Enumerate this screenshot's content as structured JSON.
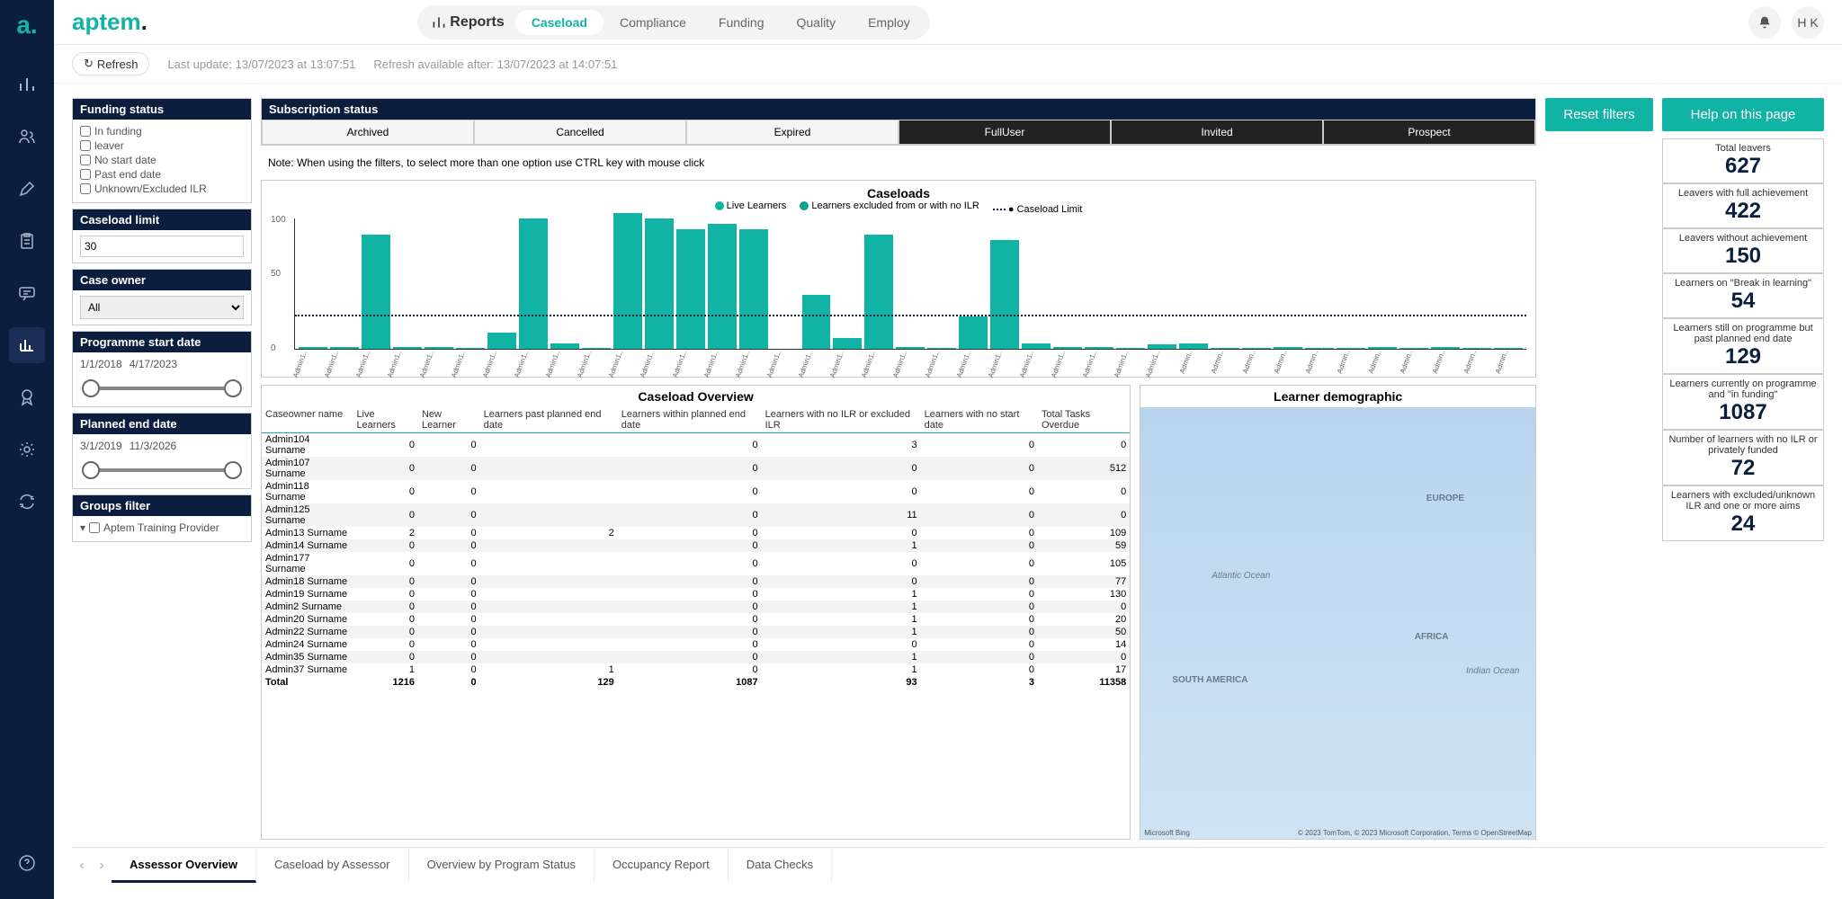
{
  "brand": "aptem",
  "top_tabs": {
    "label": "Reports",
    "items": [
      "Caseload",
      "Compliance",
      "Funding",
      "Quality",
      "Employ"
    ],
    "active": "Caseload"
  },
  "user_initials": "H K",
  "refresh": {
    "btn": "Refresh",
    "last": "Last update: 13/07/2023 at 13:07:51",
    "avail": "Refresh available after: 13/07/2023 at 14:07:51"
  },
  "filters": {
    "funding_status": {
      "title": "Funding status",
      "items": [
        "In funding",
        "leaver",
        "No start date",
        "Past end date",
        "Unknown/Excluded ILR"
      ]
    },
    "caseload_limit": {
      "title": "Caseload limit",
      "value": "30"
    },
    "case_owner": {
      "title": "Case owner",
      "value": "All"
    },
    "prog_start": {
      "title": "Programme start date",
      "from": "1/1/2018",
      "to": "4/17/2023"
    },
    "planned_end": {
      "title": "Planned end date",
      "from": "3/1/2019",
      "to": "11/3/2026"
    },
    "groups": {
      "title": "Groups filter",
      "item": "Aptem Training Provider"
    }
  },
  "sub_status": {
    "title": "Subscription status",
    "tabs": [
      "Archived",
      "Cancelled",
      "Expired",
      "FullUser",
      "Invited",
      "Prospect"
    ],
    "dark": [
      "FullUser",
      "Invited",
      "Prospect"
    ]
  },
  "note_label": "Note:",
  "note": "When using the filters, to select more than one option use CTRL key with mouse click",
  "actions": {
    "reset": "Reset filters",
    "help": "Help on this page"
  },
  "chart_data": {
    "type": "bar",
    "title": "Caseloads",
    "legend": [
      "Live Learners",
      "Learners excluded from or with no ILR",
      "Caseload Limit"
    ],
    "ylabel": "",
    "ylim": [
      0,
      120
    ],
    "yticks": [
      0,
      50,
      100
    ],
    "caseload_limit": 30,
    "categories": [
      "Admin1..",
      "Admin1..",
      "Admin1..",
      "Admin1..",
      "Admin1..",
      "Admin1..",
      "Admin1..",
      "Admin1..",
      "Admin1..",
      "Admin1..",
      "Admin1..",
      "Admin1..",
      "Admin1..",
      "Admin1..",
      "Admin1..",
      "Admin1..",
      "Admin1..",
      "Admin1..",
      "Admin1..",
      "Admin1..",
      "Admin1..",
      "Admin1..",
      "Admin1..",
      "Admin1..",
      "Admin1..",
      "Admin1..",
      "Admin1..",
      "Admin1..",
      "Admin..",
      "Admin..",
      "Admin..",
      "Admin..",
      "Admin..",
      "Admin..",
      "Admin..",
      "Admin..",
      "Admin..",
      "Admin..",
      "Admin.."
    ],
    "values": [
      2,
      2,
      105,
      2,
      2,
      1,
      15,
      120,
      5,
      1,
      125,
      120,
      110,
      115,
      110,
      0,
      50,
      10,
      105,
      2,
      1,
      30,
      100,
      5,
      2,
      2,
      1,
      4,
      5,
      1,
      1,
      2,
      1,
      1,
      2,
      1,
      2,
      1,
      1
    ]
  },
  "overview": {
    "title": "Caseload Overview",
    "cols": [
      "Caseowner name",
      "Live Learners",
      "New Learner",
      "Learners past planned end date",
      "Learners within planned end date",
      "Learners with no ILR or excluded ILR",
      "Learners with no start date",
      "Total Tasks Overdue"
    ],
    "rows": [
      [
        "Admin104 Surname",
        "0",
        "0",
        "",
        "0",
        "3",
        "0",
        "0"
      ],
      [
        "Admin107 Surname",
        "0",
        "0",
        "",
        "0",
        "0",
        "0",
        "512"
      ],
      [
        "Admin118 Surname",
        "0",
        "0",
        "",
        "0",
        "0",
        "0",
        "0"
      ],
      [
        "Admin125 Surname",
        "0",
        "0",
        "",
        "0",
        "11",
        "0",
        "0"
      ],
      [
        "Admin13 Surname",
        "2",
        "0",
        "2",
        "0",
        "0",
        "0",
        "109"
      ],
      [
        "Admin14 Surname",
        "0",
        "0",
        "",
        "0",
        "1",
        "0",
        "59"
      ],
      [
        "Admin177 Surname",
        "0",
        "0",
        "",
        "0",
        "0",
        "0",
        "105"
      ],
      [
        "Admin18 Surname",
        "0",
        "0",
        "",
        "0",
        "0",
        "0",
        "77"
      ],
      [
        "Admin19 Surname",
        "0",
        "0",
        "",
        "0",
        "1",
        "0",
        "130"
      ],
      [
        "Admin2 Surname",
        "0",
        "0",
        "",
        "0",
        "1",
        "0",
        "0"
      ],
      [
        "Admin20 Surname",
        "0",
        "0",
        "",
        "0",
        "1",
        "0",
        "20"
      ],
      [
        "Admin22 Surname",
        "0",
        "0",
        "",
        "0",
        "1",
        "0",
        "50"
      ],
      [
        "Admin24 Surname",
        "0",
        "0",
        "",
        "0",
        "0",
        "0",
        "14"
      ],
      [
        "Admin35 Surname",
        "0",
        "0",
        "",
        "0",
        "1",
        "0",
        "0"
      ],
      [
        "Admin37 Surname",
        "1",
        "0",
        "1",
        "0",
        "1",
        "0",
        "17"
      ]
    ],
    "total": [
      "Total",
      "1216",
      "0",
      "129",
      "1087",
      "93",
      "3",
      "11358"
    ]
  },
  "map": {
    "title": "Learner demographic",
    "labels": [
      "EUROPE",
      "AFRICA",
      "SOUTH AMERICA",
      "Atlantic Ocean",
      "Indian Ocean"
    ],
    "credits": "© 2023 TomTom, © 2023 Microsoft Corporation, Terms © OpenStreetMap",
    "ms": "Microsoft Bing"
  },
  "kpis": [
    {
      "label": "Total leavers",
      "value": "627"
    },
    {
      "label": "Leavers with full achievement",
      "value": "422"
    },
    {
      "label": "Leavers without achievement",
      "value": "150"
    },
    {
      "label": "Learners on \"Break in learning\"",
      "value": "54"
    },
    {
      "label": "Learners still on programme but past planned end date",
      "value": "129"
    },
    {
      "label": "Learners currently on programme and \"in funding\"",
      "value": "1087"
    },
    {
      "label": "Number of learners with no ILR or privately funded",
      "value": "72"
    },
    {
      "label": "Learners with excluded/unknown ILR and one or more aims",
      "value": "24"
    }
  ],
  "bottom_tabs": [
    "Assessor Overview",
    "Caseload by Assessor",
    "Overview by Program Status",
    "Occupancy Report",
    "Data Checks"
  ],
  "bottom_active": "Assessor Overview"
}
